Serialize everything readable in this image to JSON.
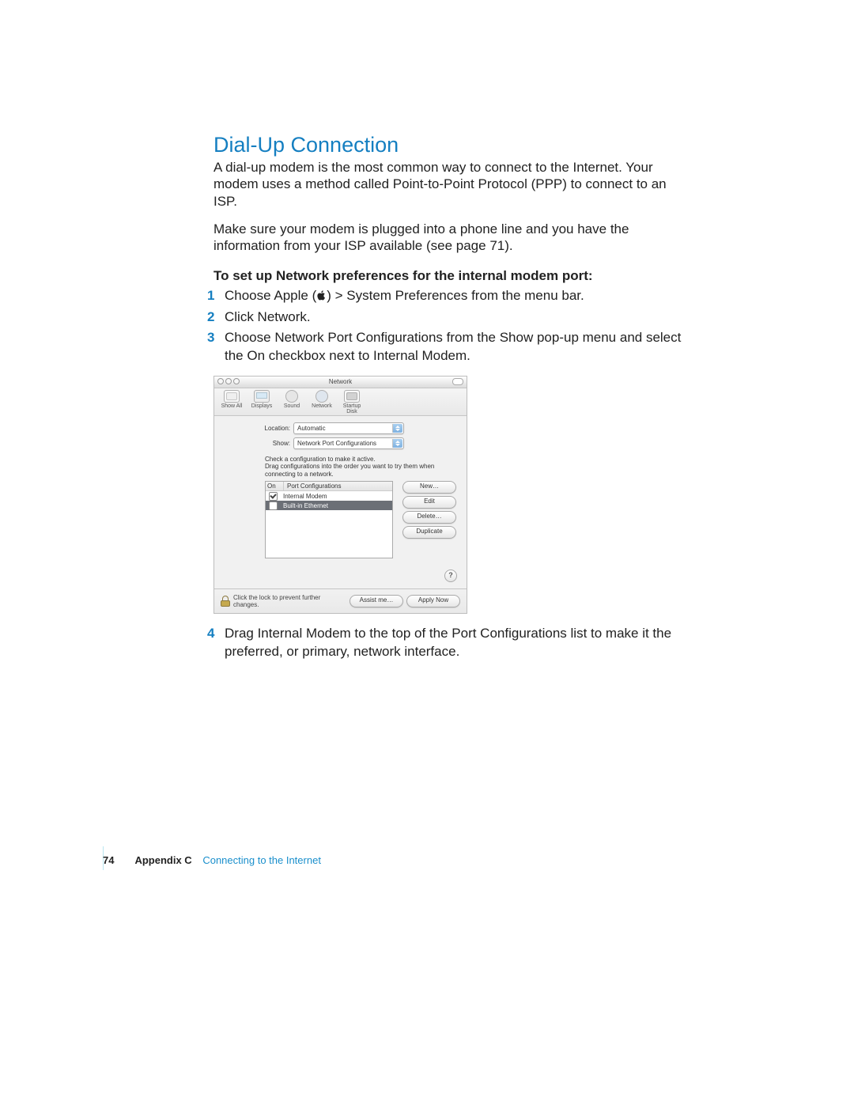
{
  "title": "Dial-Up Connection",
  "para1": "A dial-up modem is the most common way to connect to the Internet. Your modem uses a method called Point-to-Point Protocol (PPP) to connect to an ISP.",
  "para2": "Make sure your modem is plugged into a phone line and you have the information from your ISP available (see page 71).",
  "subheading": "To set up Network preferences for the internal modem port:",
  "step1_prefix": "Choose Apple (",
  "step1_suffix": ") > System Preferences from the menu bar.",
  "step2": "Click Network.",
  "step3": "Choose Network Port Configurations from the Show pop-up menu and select the On checkbox next to Internal Modem.",
  "step4": "Drag Internal Modem to the top of the Port Configurations list to make it the preferred, or primary, network interface.",
  "nums": {
    "s1": "1",
    "s2": "2",
    "s3": "3",
    "s4": "4"
  },
  "screenshot": {
    "window_title": "Network",
    "toolbar": {
      "show_all": "Show All",
      "displays": "Displays",
      "sound": "Sound",
      "network": "Network",
      "startup_disk": "Startup Disk"
    },
    "location_label": "Location:",
    "location_value": "Automatic",
    "show_label": "Show:",
    "show_value": "Network Port Configurations",
    "instructions_l1": "Check a configuration to make it active.",
    "instructions_l2": "Drag configurations into the order you want to try them when",
    "instructions_l3": "connecting to a network.",
    "col_on": "On",
    "col_name": "Port Configurations",
    "row1": "Internal Modem",
    "row2": "Built-in Ethernet",
    "btn_new": "New…",
    "btn_edit": "Edit",
    "btn_delete": "Delete…",
    "btn_duplicate": "Duplicate",
    "help": "?",
    "lock_text": "Click the lock to prevent further changes.",
    "btn_assist": "Assist me…",
    "btn_apply": "Apply Now"
  },
  "footer": {
    "page": "74",
    "appendix": "Appendix C",
    "crumb": "Connecting to the Internet"
  }
}
